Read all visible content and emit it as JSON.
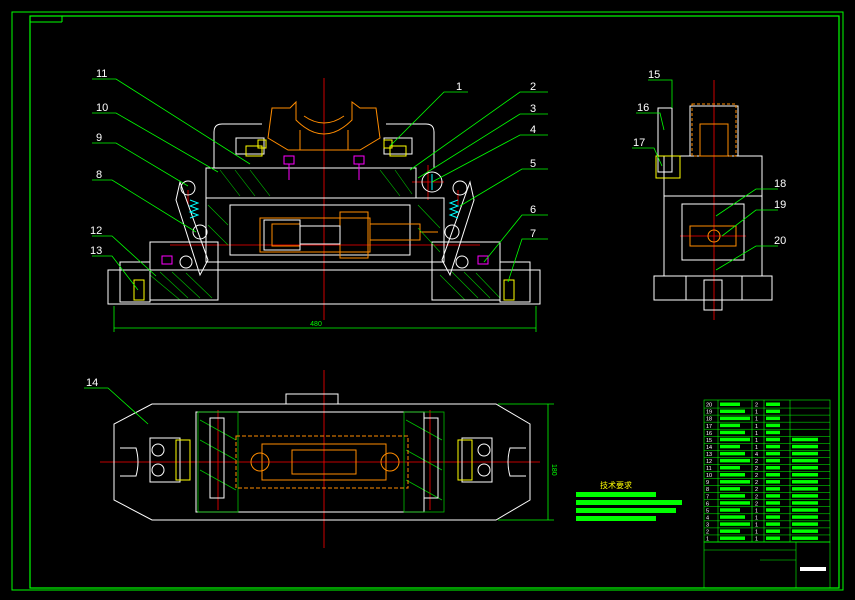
{
  "colors": {
    "background": "#000000",
    "outline": "#ffffff",
    "border": "#00ff00",
    "leader": "#00ff00",
    "center_line": "#ff0000",
    "hatch": "#00c000",
    "part_orange": "#ff8c00",
    "fastener_magenta": "#ff00ff",
    "detail_yellow": "#ffff00",
    "detail_cyan": "#00ffff",
    "label_text": "#ffffff"
  },
  "front_view": {
    "part_labels": [
      "1",
      "2",
      "3",
      "4",
      "5",
      "6",
      "7",
      "8",
      "9",
      "10",
      "11",
      "12",
      "13"
    ],
    "dimension_width": "480"
  },
  "top_view": {
    "part_label": "14",
    "dimension_height": "180"
  },
  "side_view": {
    "part_labels": [
      "15",
      "16",
      "17",
      "18",
      "19",
      "20"
    ]
  },
  "notes": {
    "title": "技术要求"
  },
  "parts_list": {
    "numbers": [
      "20",
      "19",
      "18",
      "17",
      "16",
      "15",
      "14",
      "13",
      "12",
      "11",
      "10",
      "9",
      "8",
      "7",
      "6",
      "5",
      "4",
      "3",
      "2",
      "1"
    ],
    "quantities": [
      "2",
      "1",
      "1",
      "1",
      "1",
      "1",
      "1",
      "4",
      "2",
      "2",
      "2",
      "2",
      "2",
      "2",
      "2",
      "1",
      "1",
      "1",
      "1",
      "1"
    ]
  }
}
